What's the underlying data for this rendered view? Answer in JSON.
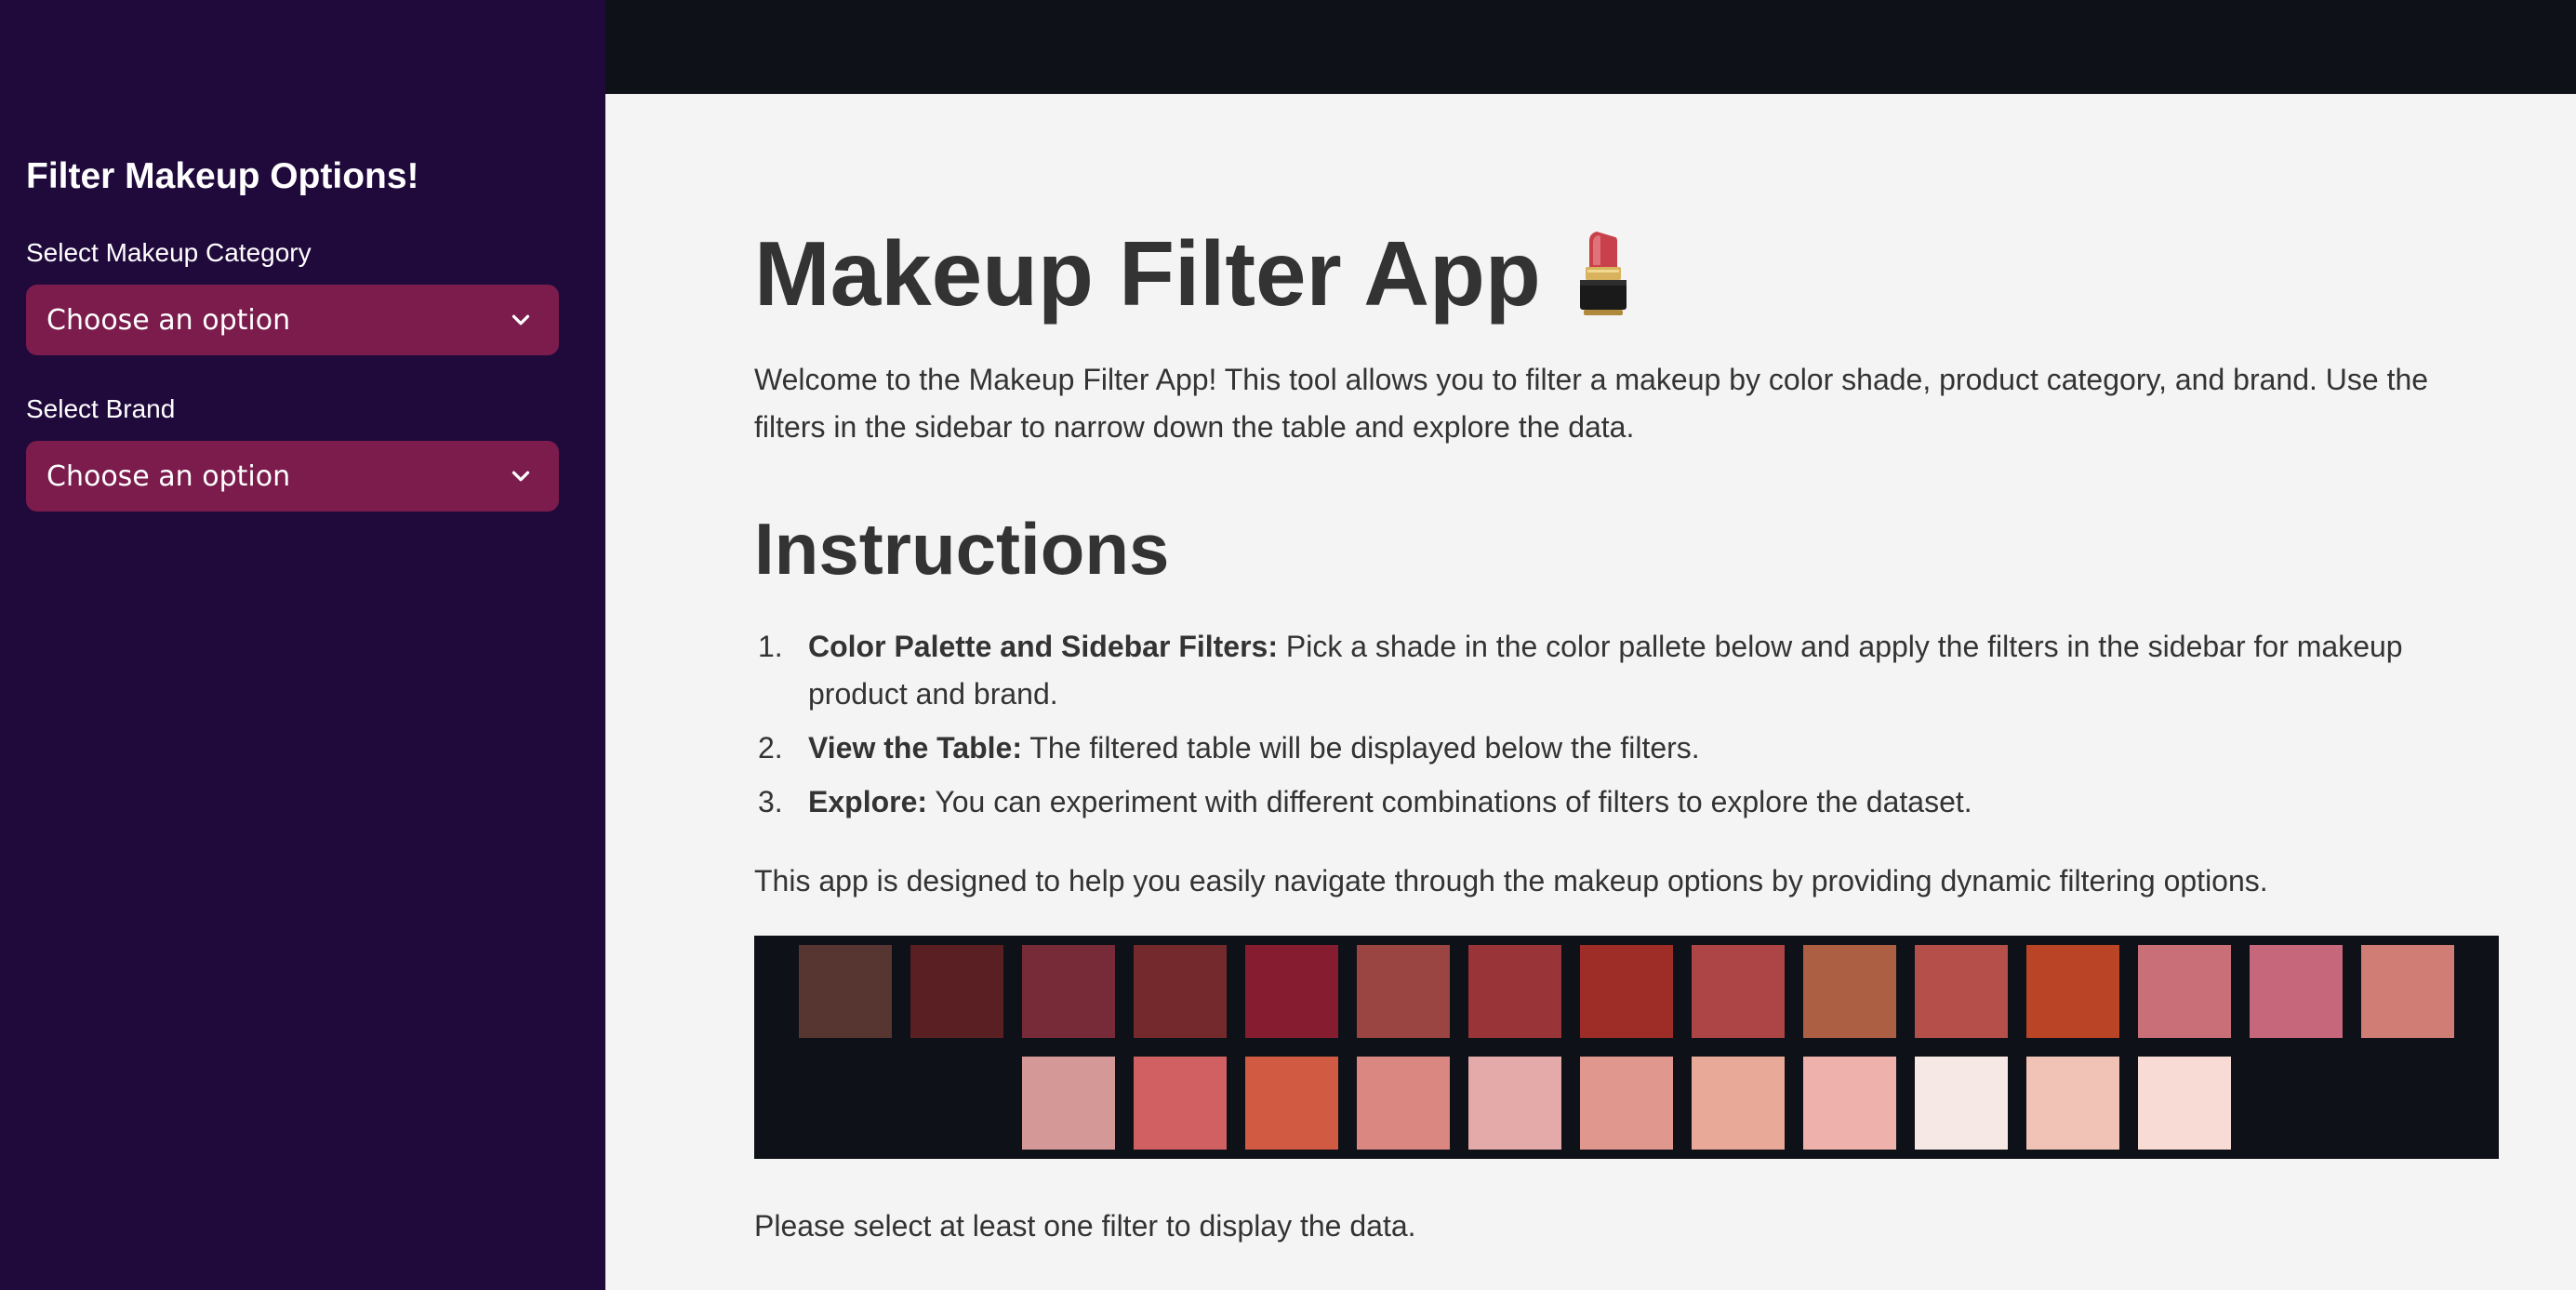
{
  "sidebar": {
    "title": "Filter Makeup Options!",
    "category_label": "Select Makeup Category",
    "category_value": "Choose an option",
    "brand_label": "Select Brand",
    "brand_value": "Choose an option"
  },
  "main": {
    "title": "Makeup Filter App",
    "title_icon": "lipstick-icon",
    "intro": "Welcome to the Makeup Filter App! This tool allows you to filter a makeup by color shade, product category, and brand. Use the filters in the sidebar to narrow down the table and explore the data.",
    "instructions_heading": "Instructions",
    "instructions": [
      {
        "num": "1.",
        "bold": "Color Palette and Sidebar Filters:",
        "text": " Pick a shade in the color pallete below and apply the filters in the sidebar for makeup product and brand."
      },
      {
        "num": "2.",
        "bold": "View the Table:",
        "text": " The filtered table will be displayed below the filters."
      },
      {
        "num": "3.",
        "bold": "Explore:",
        "text": " You can experiment with different combinations of filters to explore the dataset."
      }
    ],
    "summary": "This app is designed to help you easily navigate through the makeup options by providing dynamic filtering options.",
    "empty_message": "Please select at least one filter to display the data."
  },
  "palette": {
    "row1": [
      "#573531",
      "#5a1f22",
      "#772b38",
      "#742a2d",
      "#861c2f",
      "#9a4541",
      "#993538",
      "#9d2d26",
      "#ad4546",
      "#ad5f43",
      "#b54f4a",
      "#b94426",
      "#c96f78",
      "#c7677b",
      "#d07d76"
    ],
    "row2": [
      "#d49996",
      "#d06062",
      "#d05a42",
      "#da8681",
      "#e3aaa9",
      "#e0978d",
      "#e9a999",
      "#eeb1ab",
      "#f6e8e5",
      "#f1c3b6",
      "#f7dbd4"
    ]
  },
  "colors": {
    "sidebar_bg": "#200a3c",
    "select_bg": "#7b1c4c",
    "topbar_bg": "#0e1117",
    "main_bg": "#f4f4f4",
    "text": "#333333"
  }
}
